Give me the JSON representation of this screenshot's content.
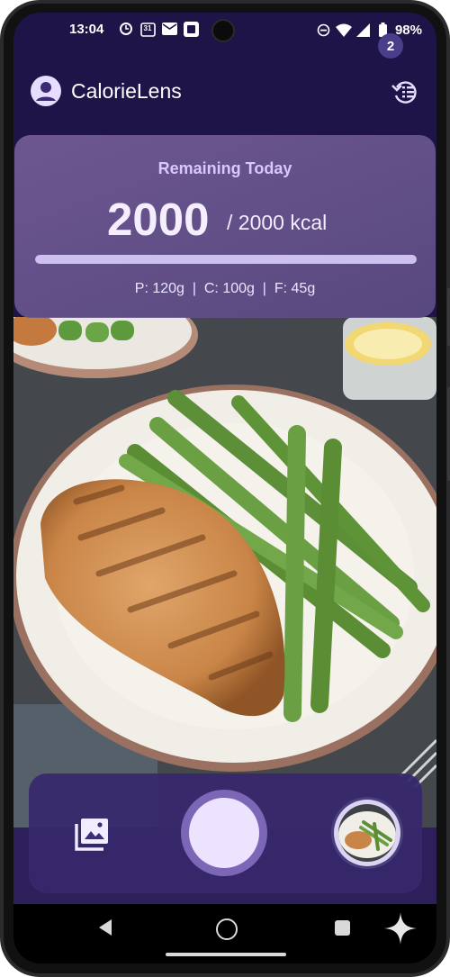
{
  "status_bar": {
    "time": "13:04",
    "calendar_day": "31",
    "battery": "98%"
  },
  "app_bar": {
    "title": "CalorieLens"
  },
  "summary": {
    "label": "Remaining Today",
    "remaining": "2000",
    "total": "/ 2000 kcal",
    "progress_fraction": 1.0,
    "macros": "P: 120g  |  C: 100g  |  F: 45g"
  },
  "capture": {
    "queue_count": "2"
  },
  "colors": {
    "accent": "#7c67b7",
    "bar_fill": "#ccc0ee",
    "background": "#1f1448"
  }
}
